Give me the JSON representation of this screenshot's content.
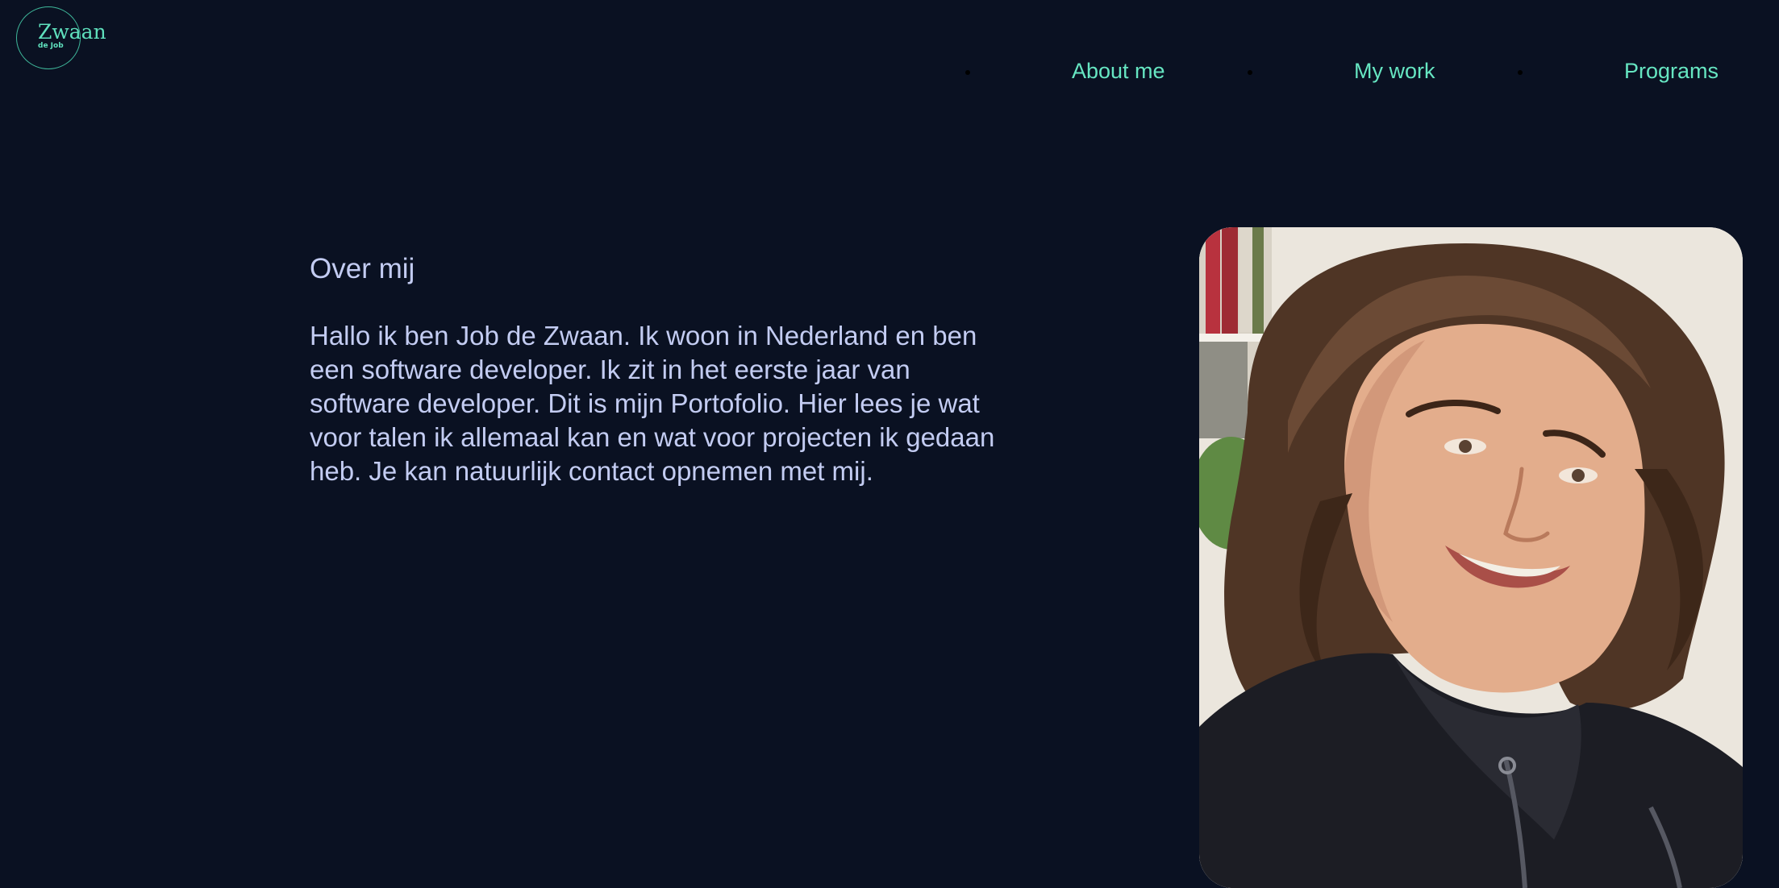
{
  "logo": {
    "main_text": "Zwaan",
    "sub_text": "de Job"
  },
  "nav": {
    "items": [
      {
        "label": "About me"
      },
      {
        "label": "My work"
      },
      {
        "label": "Programs"
      }
    ]
  },
  "about": {
    "heading": "Over mij",
    "body": "Hallo ik ben Job de Zwaan. Ik woon in Nederland en ben een software developer. Ik zit in het eerste jaar van software developer. Dit is mijn Portofolio. Hier lees je wat voor talen ik allemaal kan en wat voor projecten ik gedaan heb. Je kan natuurlijk contact opnemen met mij."
  },
  "colors": {
    "background": "#0a1122",
    "accent": "#66e6c2",
    "text": "#c3ccf2"
  }
}
